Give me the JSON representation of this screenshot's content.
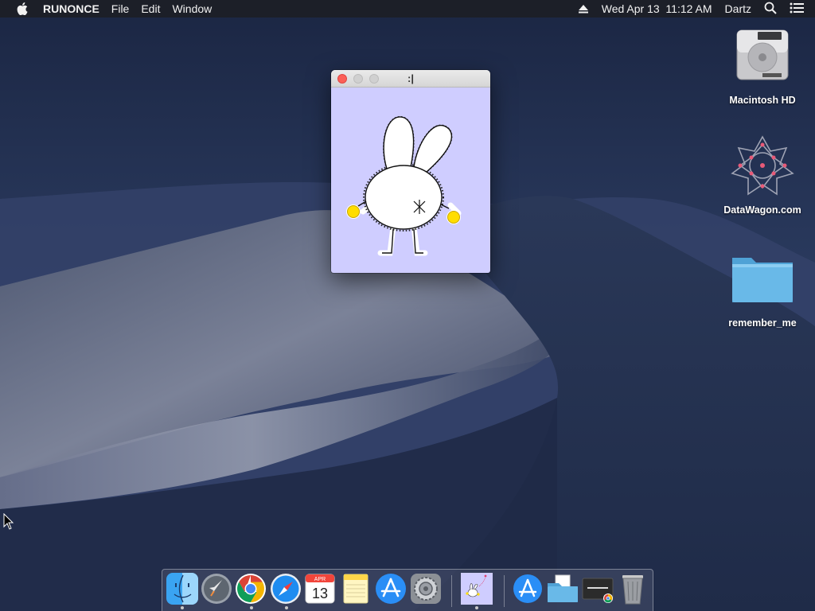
{
  "menubar": {
    "app_name": "RUNONCE",
    "menus": [
      "File",
      "Edit",
      "Window"
    ],
    "datetime": "Wed Apr 13  11:12 AM",
    "user": "Dartz"
  },
  "window": {
    "title": ":|"
  },
  "desktop_icons": [
    {
      "label": "Macintosh HD",
      "icon": "hard-drive-icon"
    },
    {
      "label": "DataWagon.com",
      "icon": "datawagon-icon"
    },
    {
      "label": "remember_me",
      "icon": "folder-icon"
    }
  ],
  "dock": {
    "items": [
      "Finder",
      "Launchpad",
      "Google Chrome",
      "Safari",
      "Calendar",
      "Notes",
      "App Store",
      "System Preferences",
      "RUNONCE",
      "Applications",
      "Documents",
      "Chrome App",
      "Trash"
    ],
    "calendar_month": "APR",
    "calendar_day": "13"
  },
  "colors": {
    "window_bg": "#cfcdff",
    "close_button": "#fc5f57",
    "menubar": "#1c1e26"
  }
}
